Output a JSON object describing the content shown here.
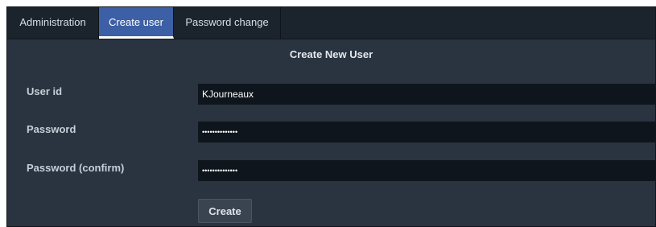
{
  "tabs": [
    {
      "label": "Administration",
      "active": false
    },
    {
      "label": "Create user",
      "active": true
    },
    {
      "label": "Password change",
      "active": false
    }
  ],
  "form": {
    "title": "Create New User",
    "user_id_label": "User id",
    "user_id_value": "KJourneaux",
    "password_label": "Password",
    "password_value": "••••••••••••••",
    "password_confirm_label": "Password (confirm)",
    "password_confirm_value": "••••••••••••••",
    "create_button_label": "Create"
  },
  "colors": {
    "panel_bg": "#2a3440",
    "tabbar_bg": "#1b232c",
    "active_tab_bg": "#3c5fa6",
    "input_bg": "#0e151c"
  }
}
